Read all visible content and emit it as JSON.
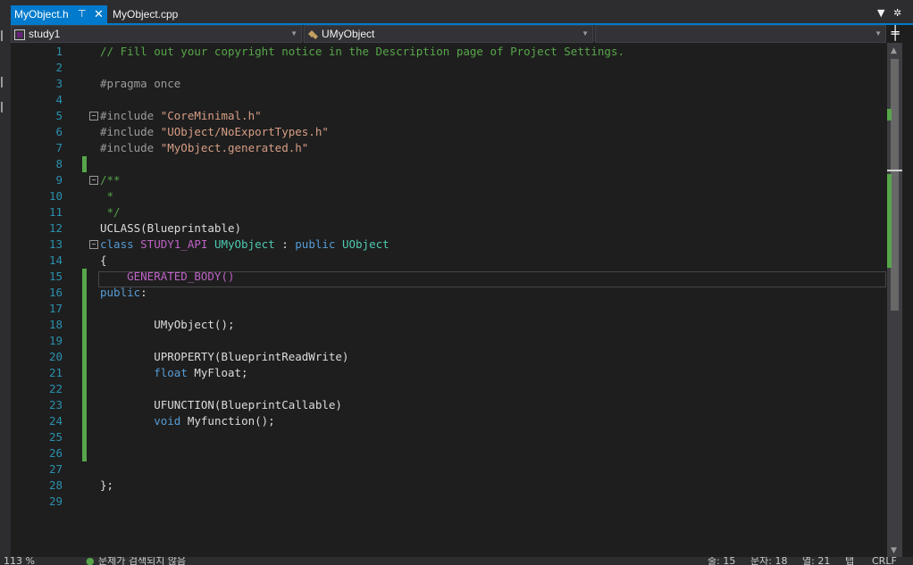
{
  "tabs": [
    {
      "label": "MyObject.h",
      "active": true,
      "pinned": true
    },
    {
      "label": "MyObject.cpp",
      "active": false
    }
  ],
  "navbar": {
    "project": "study1",
    "scope": "UMyObject",
    "member": ""
  },
  "icons": {
    "pin": "pin-icon",
    "close": "close-icon",
    "split": "split-icon"
  },
  "colors": {
    "accent": "#007acc",
    "comment": "#57a64a",
    "keyword": "#569cd6",
    "type": "#4ec9b0",
    "macro": "#bd63c5",
    "string": "#d69d85",
    "line_number": "#2b91af"
  },
  "code_lines": [
    {
      "n": "1",
      "tokens": [
        {
          "t": "// Fill out your copyright notice in the Description page of Project Settings.",
          "c": "cmt"
        }
      ]
    },
    {
      "n": "2",
      "tokens": []
    },
    {
      "n": "3",
      "tokens": [
        {
          "t": "#pragma once",
          "c": "pre"
        }
      ]
    },
    {
      "n": "4",
      "tokens": []
    },
    {
      "n": "5",
      "fold": "−",
      "tokens": [
        {
          "t": "#include ",
          "c": "pre"
        },
        {
          "t": "\"CoreMinimal.h\"",
          "c": "str"
        }
      ]
    },
    {
      "n": "6",
      "tokens": [
        {
          "t": "#include ",
          "c": "pre"
        },
        {
          "t": "\"UObject/NoExportTypes.h\"",
          "c": "str"
        }
      ]
    },
    {
      "n": "7",
      "tokens": [
        {
          "t": "#include ",
          "c": "pre"
        },
        {
          "t": "\"MyObject.generated.h\"",
          "c": "str"
        }
      ]
    },
    {
      "n": "8",
      "tokens": []
    },
    {
      "n": "9",
      "fold": "−",
      "tokens": [
        {
          "t": "/**",
          "c": "cmt"
        }
      ]
    },
    {
      "n": "10",
      "tokens": [
        {
          "t": " *",
          "c": "cmt"
        }
      ]
    },
    {
      "n": "11",
      "tokens": [
        {
          "t": " */",
          "c": "cmt"
        }
      ]
    },
    {
      "n": "12",
      "tokens": [
        {
          "t": "UCLASS(Blueprintable)",
          "c": "id"
        }
      ]
    },
    {
      "n": "13",
      "fold": "−",
      "tokens": [
        {
          "t": "class ",
          "c": "kw"
        },
        {
          "t": "STUDY1_API ",
          "c": "mac"
        },
        {
          "t": "UMyObject ",
          "c": "typ"
        },
        {
          "t": ": ",
          "c": "id"
        },
        {
          "t": "public ",
          "c": "kw"
        },
        {
          "t": "UObject",
          "c": "typ"
        }
      ]
    },
    {
      "n": "14",
      "tokens": [
        {
          "t": "{",
          "c": "id"
        }
      ]
    },
    {
      "n": "15",
      "tokens": [
        {
          "t": "    GENERATED_BODY()",
          "c": "mac"
        }
      ]
    },
    {
      "n": "16",
      "tokens": [
        {
          "t": "public",
          "c": "kw"
        },
        {
          "t": ":",
          "c": "id"
        }
      ]
    },
    {
      "n": "17",
      "tokens": []
    },
    {
      "n": "18",
      "tokens": [
        {
          "t": "        UMyObject();",
          "c": "id"
        }
      ]
    },
    {
      "n": "19",
      "tokens": []
    },
    {
      "n": "20",
      "tokens": [
        {
          "t": "        UPROPERTY(BlueprintReadWrite)",
          "c": "id"
        }
      ]
    },
    {
      "n": "21",
      "tokens": [
        {
          "t": "        ",
          "c": "id"
        },
        {
          "t": "float ",
          "c": "kw"
        },
        {
          "t": "MyFloat;",
          "c": "id"
        }
      ]
    },
    {
      "n": "22",
      "tokens": []
    },
    {
      "n": "23",
      "tokens": [
        {
          "t": "        UFUNCTION(BlueprintCallable)",
          "c": "id"
        }
      ]
    },
    {
      "n": "24",
      "tokens": [
        {
          "t": "        ",
          "c": "id"
        },
        {
          "t": "void ",
          "c": "kw"
        },
        {
          "t": "Myfunction();",
          "c": "id"
        }
      ]
    },
    {
      "n": "25",
      "tokens": []
    },
    {
      "n": "26",
      "tokens": []
    },
    {
      "n": "27",
      "tokens": []
    },
    {
      "n": "28",
      "tokens": [
        {
          "t": "};",
          "c": "id"
        }
      ]
    },
    {
      "n": "29",
      "tokens": []
    }
  ],
  "status": {
    "zoom": "113 %",
    "issues": "문제가 검색되지 않음",
    "line": "줄: 15",
    "char": "문자: 18",
    "col": "열: 21",
    "mode": "탭",
    "eol": "CRLF"
  }
}
